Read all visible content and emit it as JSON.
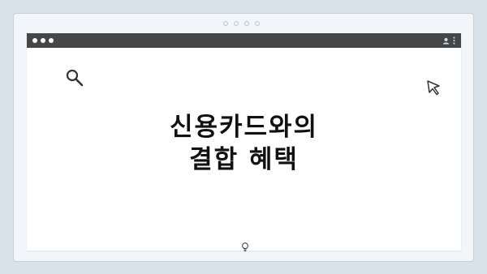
{
  "window": {
    "title_line_1": "신용카드와의",
    "title_line_2": "결합 혜택"
  },
  "icons": {
    "search": "search-icon",
    "cursor": "cursor-icon",
    "bulb": "lightbulb-icon",
    "user": "user-icon",
    "menu": "kebab-menu-icon"
  }
}
